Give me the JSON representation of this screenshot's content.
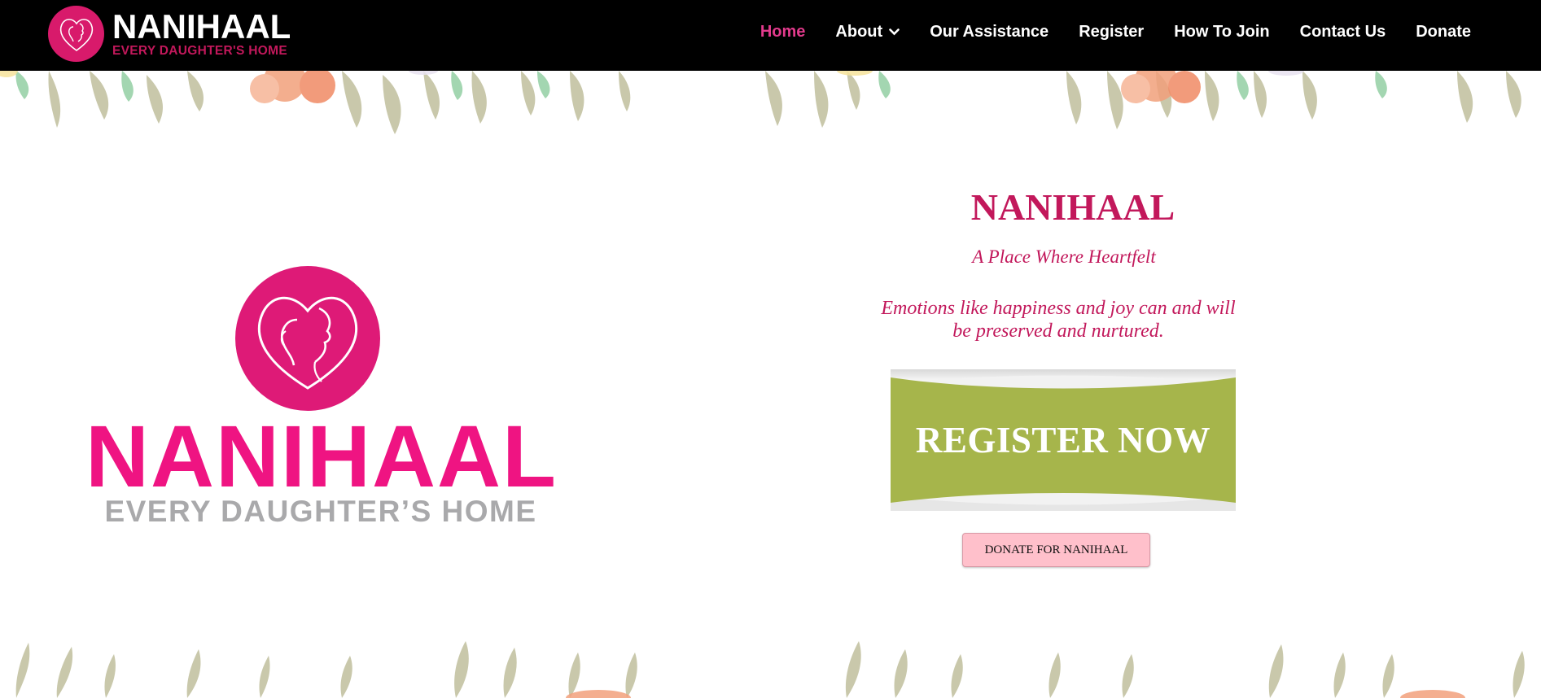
{
  "brand": {
    "name": "NANIHAAL",
    "tagline": "EVERY DAUGHTER'S HOME"
  },
  "nav": {
    "items": [
      {
        "label": "Home",
        "active": true
      },
      {
        "label": "About",
        "active": false,
        "dropdown": true
      },
      {
        "label": "Our Assistance",
        "active": false
      },
      {
        "label": "Register",
        "active": false
      },
      {
        "label": "How To Join",
        "active": false
      },
      {
        "label": "Contact Us",
        "active": false
      },
      {
        "label": "Donate",
        "active": false
      }
    ]
  },
  "hero_logo": {
    "name": "NANIHAAL",
    "tagline": "EVERY DAUGHTER’S HOME"
  },
  "hero": {
    "title": "NANIHAAL",
    "subtitle": "A Place Where Heartfelt",
    "description": "Emotions like happiness and joy can and will be preserved and nurtured.",
    "register_label": "REGISTER NOW",
    "donate_label": "DONATE FOR NANIHAAL"
  },
  "colors": {
    "nav_bg": "#000000",
    "brand_pink": "#c2185b",
    "active_nav": "#e23a8c",
    "logo_pink": "#ef1482",
    "register_green": "#a6b54b",
    "donate_pink": "#ffc0cb"
  }
}
